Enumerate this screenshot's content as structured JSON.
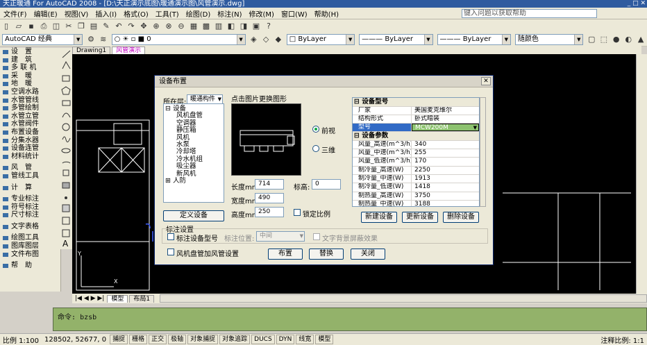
{
  "window": {
    "title": "天正暖通 For AutoCAD 2008 - [D:\\天正演示底图\\暖通演示图\\风管演示.dwg]"
  },
  "menu": [
    "文件(F)",
    "编辑(E)",
    "视图(V)",
    "插入(I)",
    "格式(O)",
    "工具(T)",
    "绘图(D)",
    "标注(N)",
    "修改(M)",
    "窗口(W)",
    "帮助(H)"
  ],
  "help_placeholder": "键入问题以获取帮助",
  "toolbar": {
    "workspace": "AutoCAD 经典",
    "layer": "0",
    "color": "ByLayer",
    "linetype": "ByLayer",
    "lineweight": "ByLayer",
    "plotstyle": "随颜色"
  },
  "left_menu": [
    "设　置",
    "建　筑",
    "多 联 机",
    "采　暖",
    "地　暖",
    "空调水路",
    "水管管线",
    "多管绘制",
    "水管立管",
    "水管阀件",
    "布置设备",
    "分集水器",
    "设备连管",
    "材料统计",
    "风　管",
    "管线工具",
    "计　算",
    "专业标注",
    "符号标注",
    "尺寸标注",
    "文字表格",
    "绘图工具",
    "图库图层",
    "文件布图",
    "帮　助"
  ],
  "doc_tabs": [
    "Drawing1",
    "风管演示"
  ],
  "layout_tabs": [
    "模型",
    "布局1"
  ],
  "command": {
    "prompt": "命令:",
    "text": "bzsb"
  },
  "status": {
    "scale": "比例 1:100",
    "coords": "128502, 52677, 0",
    "toggles": [
      "捕捉",
      "栅格",
      "正交",
      "极轴",
      "对象捕捉",
      "对象追踪",
      "DUCS",
      "DYN",
      "线宽",
      "模型"
    ],
    "annot": "注释比例: 1:1"
  },
  "dialog": {
    "title": "设备布置",
    "layer_label": "所在层:",
    "layer_value": "暖通构件",
    "tree": [
      {
        "t": "⊟ 设备",
        "l": 0
      },
      {
        "t": "风机盘管",
        "l": 1
      },
      {
        "t": "空调器",
        "l": 1
      },
      {
        "t": "静压箱",
        "l": 1
      },
      {
        "t": "风机",
        "l": 1
      },
      {
        "t": "水泵",
        "l": 1
      },
      {
        "t": "冷却塔",
        "l": 1
      },
      {
        "t": "冷水机组",
        "l": 1
      },
      {
        "t": "吸尘器",
        "l": 1
      },
      {
        "t": "新风机",
        "l": 1
      },
      {
        "t": "⊞ 人防",
        "l": 0
      }
    ],
    "define_btn": "定义设备",
    "preview_label": "点击图片更换图形",
    "view_front": "前视",
    "view_3d": "三维",
    "length_label": "长度mm:",
    "length_value": "714",
    "width_label": "宽度mm:",
    "width_value": "490",
    "height_label": "高度mm:",
    "height_value": "250",
    "elev_label": "标高:",
    "elev_value": "0",
    "lock_ratio": "锁定比例",
    "props": {
      "group1": "设备型号",
      "rows1": [
        [
          "厂家",
          "美国麦克维尔"
        ],
        [
          "结构形式",
          "卧式暗装"
        ]
      ],
      "model_key": "型号",
      "model_value": "MCW200M",
      "group2": "设备参数",
      "rows2": [
        [
          "风量_高速(m^3/h)",
          "340"
        ],
        [
          "风量_中速(m^3/h)",
          "255"
        ],
        [
          "风量_低速(m^3/h)",
          "170"
        ],
        [
          "制冷量_高速(W)",
          "2250"
        ],
        [
          "制冷量_中速(W)",
          "1913"
        ],
        [
          "制冷量_低速(W)",
          "1418"
        ],
        [
          "制热量_高速(W)",
          "3750"
        ],
        [
          "制热量_中速(W)",
          "3188"
        ]
      ]
    },
    "new_btn": "新建设备",
    "update_btn": "更新设备",
    "delete_btn": "删除设备",
    "annot_title": "标注设置",
    "annot_model": "标注设备型号",
    "annot_pos_label": "标注位置:",
    "annot_pos_value": "中间",
    "text_mask": "文字背景屏蔽效果",
    "fcu_duct": "风机盘管加风管设置",
    "btn_place": "布置",
    "btn_replace": "替换",
    "btn_close": "关闭"
  }
}
